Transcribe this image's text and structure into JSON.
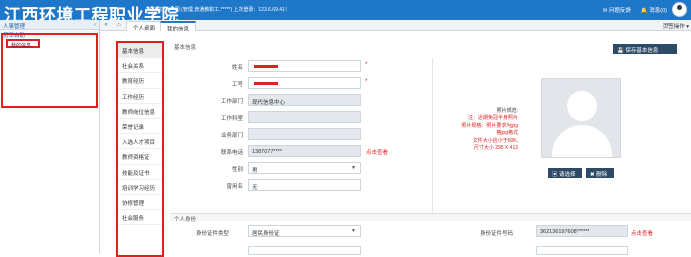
{
  "header": {
    "logo": "江西环境工程职业学院",
    "welcome": "欢迎您！****同 (管理,普通教职工,*****) 上次登录：123.6.69.41！",
    "links": [
      "问题反馈",
      "消息(0)"
    ],
    "colors": {
      "brand": "#1f77c9",
      "highlight": "#e02020",
      "dark_button": "#2d4a66"
    }
  },
  "sidebar": {
    "header": "人事管理",
    "header_icon": "chevron-left-icon",
    "group": "员工自助",
    "group_icon": "chevron-down-icon",
    "item": "我的信息"
  },
  "tabs": {
    "prev": "«",
    "home_icon": "home-icon",
    "items": [
      "个人桌面",
      "我的信息"
    ],
    "next": "»",
    "page_ops": "页签操作 ▾"
  },
  "left_nav": [
    "基本信息",
    "社会关系",
    "教育经历",
    "工作经历",
    "教师岗位信息",
    "荣誉记录",
    "入选人才项目",
    "教师资格证",
    "技能及证书",
    "培训学习经历",
    "协修管理",
    "社会服务"
  ],
  "form": {
    "section_title": "基本信息",
    "save_button": "保存基本信息",
    "fields": [
      {
        "label": "姓名",
        "value": "",
        "required": "*"
      },
      {
        "label": "工号",
        "value": "",
        "required": "*"
      },
      {
        "label": "工作部门",
        "value": "现代信息中心"
      },
      {
        "label": "工作科室",
        "value": ""
      },
      {
        "label": "业务部门",
        "value": ""
      },
      {
        "label": "联系电话",
        "value": "1387077****",
        "action": "点击查看"
      },
      {
        "label": "性别",
        "value": "男"
      },
      {
        "label": "曾用名",
        "value": "无"
      }
    ]
  },
  "photo": {
    "notes": [
      "照片规范:",
      "注：近期免冠半身照片",
      "照片规格：照片要求为jpg",
      "格jpg格式",
      "文件大小应小于60K,",
      "尺寸大小 295 X 413"
    ],
    "choose_button": "请选择",
    "delete_button": "删除"
  },
  "personal": {
    "title": "个人身份",
    "id_type_label": "身份证件类型",
    "id_type_value": "居民身份证",
    "id_number_label": "身份证件号码",
    "id_number_value": "362136197608******",
    "id_action": "点击查看"
  }
}
